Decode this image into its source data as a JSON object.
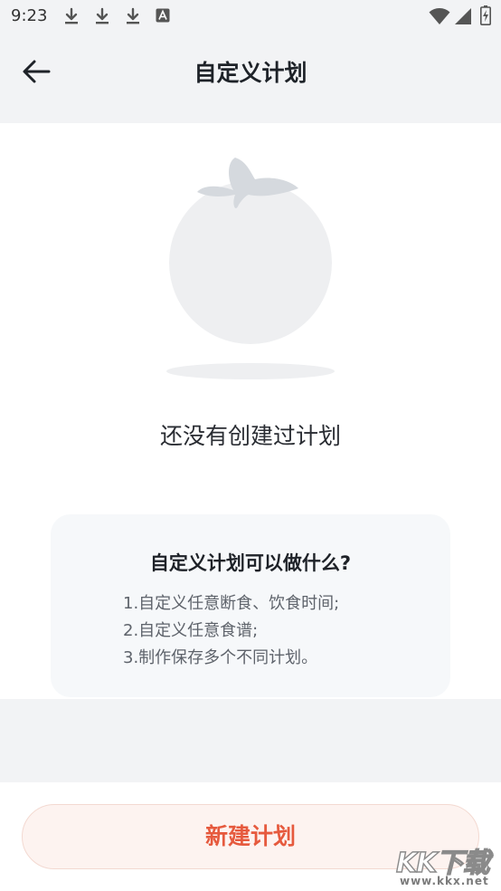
{
  "status_bar": {
    "time": "9:23",
    "icons": [
      "download-icon",
      "download-icon",
      "download-icon",
      "app-notification-icon",
      "wifi-icon",
      "signal-icon",
      "battery-charging-icon"
    ]
  },
  "header": {
    "back_icon": "arrow-left-icon",
    "title": "自定义计划"
  },
  "empty_state": {
    "illustration": "tomato-icon",
    "message": "还没有创建过计划"
  },
  "info_card": {
    "title": "自定义计划可以做什么?",
    "items": [
      "1.自定义任意断食、饮食时间;",
      "2.自定义任意食谱;",
      "3.制作保存多个不同计划。"
    ]
  },
  "action": {
    "new_plan_label": "新建计划"
  },
  "watermark": {
    "logo": "KK下载",
    "url": "www.kkx.net"
  },
  "colors": {
    "background": "#f2f3f5",
    "accent": "#e65a3e",
    "button_bg": "#fdf3f0",
    "illustration": "#eeeff1"
  }
}
